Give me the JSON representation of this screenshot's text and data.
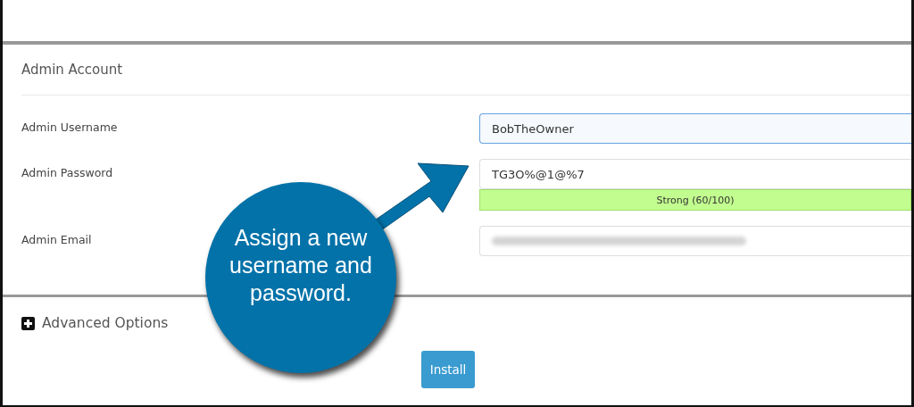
{
  "section": {
    "title": "Admin Account"
  },
  "fields": [
    {
      "label": "Admin Username",
      "value": "BobTheOwner",
      "focused": true
    },
    {
      "label": "Admin Password",
      "value": "TG3O%@1@%7",
      "focused": false,
      "strength": {
        "label": "Strong (60/100)"
      }
    },
    {
      "label": "Admin Email",
      "focused": false,
      "blurred": true
    }
  ],
  "advanced": {
    "label": "Advanced Options",
    "expanded": false
  },
  "install_button": "Install",
  "callout": "Assign a new username and password."
}
